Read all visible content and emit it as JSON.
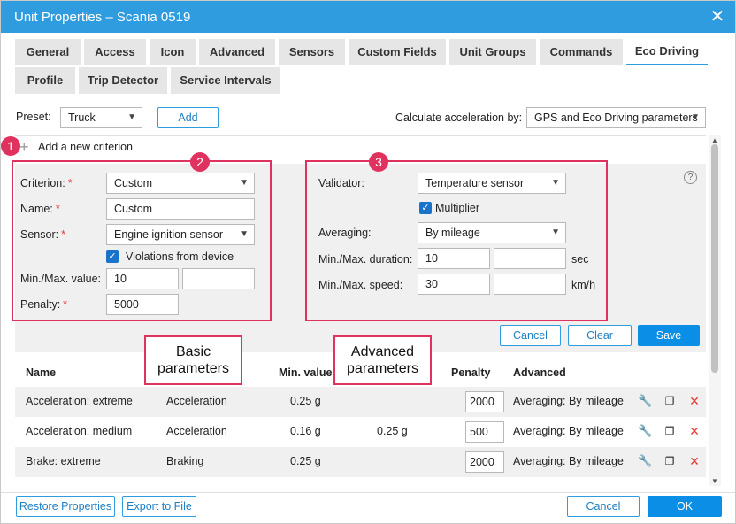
{
  "window": {
    "title": "Unit Properties – Scania 0519",
    "close_icon": "close-icon"
  },
  "tabs": [
    {
      "label": "General"
    },
    {
      "label": "Access"
    },
    {
      "label": "Icon"
    },
    {
      "label": "Advanced"
    },
    {
      "label": "Sensors"
    },
    {
      "label": "Custom Fields"
    },
    {
      "label": "Unit Groups"
    },
    {
      "label": "Commands"
    },
    {
      "label": "Eco Driving",
      "active": true
    },
    {
      "label": "Profile"
    },
    {
      "label": "Trip Detector"
    },
    {
      "label": "Service Intervals"
    }
  ],
  "preset": {
    "label": "Preset:",
    "value": "Truck",
    "add_button": "Add"
  },
  "acceleration": {
    "label": "Calculate acceleration by:",
    "value": "GPS and Eco Driving parameters"
  },
  "add_criterion": {
    "label": "Add a new criterion"
  },
  "basic": {
    "criterion_label": "Criterion:",
    "criterion_value": "Custom",
    "name_label": "Name:",
    "name_value": "Custom",
    "sensor_label": "Sensor:",
    "sensor_value": "Engine ignition sensor",
    "violations_label": "Violations from device",
    "violations_checked": true,
    "minmax_label": "Min./Max. value:",
    "min_value": "10",
    "max_value": "",
    "penalty_label": "Penalty:",
    "penalty_value": "5000",
    "required_mark": "*"
  },
  "advanced": {
    "validator_label": "Validator:",
    "validator_value": "Temperature sensor",
    "multiplier_label": "Multiplier",
    "multiplier_checked": true,
    "averaging_label": "Averaging:",
    "averaging_value": "By mileage",
    "duration_label": "Min./Max. duration:",
    "duration_min": "10",
    "duration_max": "",
    "duration_unit": "sec",
    "speed_label": "Min./Max. speed:",
    "speed_min": "30",
    "speed_max": "",
    "speed_unit": "km/h"
  },
  "form_buttons": {
    "cancel": "Cancel",
    "clear": "Clear",
    "save": "Save"
  },
  "annotations": {
    "badge1": "1",
    "badge2": "2",
    "badge3": "3",
    "callout_basic": [
      "Basic",
      "parameters"
    ],
    "callout_advanced": [
      "Advanced",
      "parameters"
    ],
    "accent_color": "#e0325f"
  },
  "table": {
    "headers": {
      "name": "Name",
      "min": "Min. value",
      "penalty": "Penalty",
      "advanced": "Advanced"
    },
    "rows": [
      {
        "name": "Acceleration: extreme",
        "type": "Acceleration",
        "min": "0.25 g",
        "max": "",
        "penalty": "2000",
        "advanced": "Averaging: By mileage"
      },
      {
        "name": "Acceleration: medium",
        "type": "Acceleration",
        "min": "0.16 g",
        "max": "0.25 g",
        "penalty": "500",
        "advanced": "Averaging: By mileage"
      },
      {
        "name": "Brake: extreme",
        "type": "Braking",
        "min": "0.25 g",
        "max": "",
        "penalty": "2000",
        "advanced": "Averaging: By mileage"
      }
    ]
  },
  "footer": {
    "restore": "Restore Properties",
    "export": "Export to File",
    "cancel": "Cancel",
    "ok": "OK"
  },
  "colors": {
    "titlebar": "#2f9ce0",
    "primary_button": "#0b8fe6",
    "delete_icon": "#e53935"
  }
}
